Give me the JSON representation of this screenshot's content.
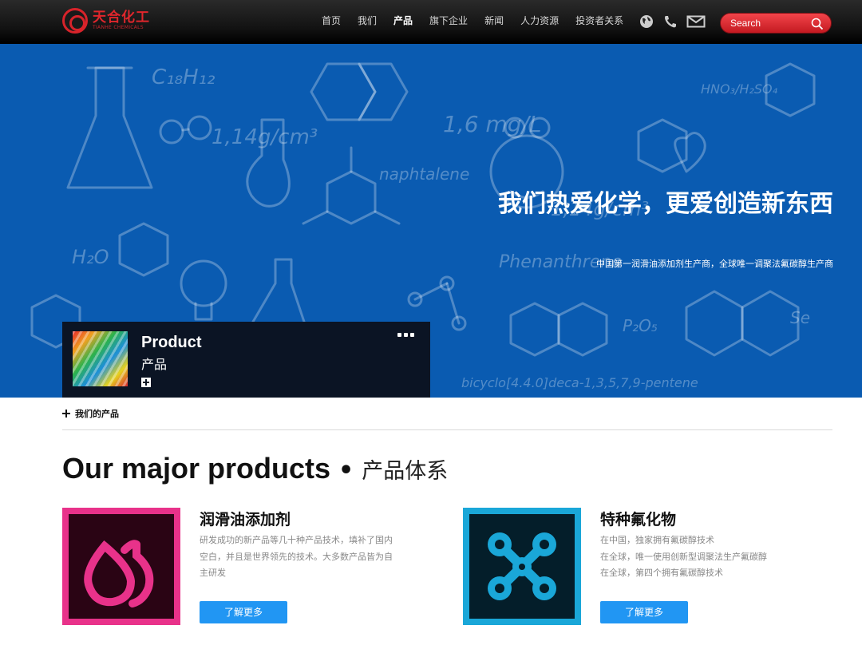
{
  "colors": {
    "accent_red": "#e0262c",
    "hero_blue": "#0a5bb1",
    "button_blue": "#2196f3",
    "product1_border": "#e8328a",
    "product2_border": "#1aa7d8"
  },
  "header": {
    "logo": {
      "cn": "天合化工",
      "en": "TIANHE CHEMICALS"
    },
    "nav": [
      {
        "label": "首页"
      },
      {
        "label": "我们"
      },
      {
        "label": "产品",
        "active": true
      },
      {
        "label": "旗下企业"
      },
      {
        "label": "新闻"
      },
      {
        "label": "人力资源"
      },
      {
        "label": "投资者关系"
      }
    ],
    "icons": [
      "globe-icon",
      "phone-icon",
      "mail-icon"
    ],
    "search": {
      "placeholder": "Search"
    }
  },
  "hero": {
    "title": "我们热爱化学，更爱创造新东西",
    "subtitle": "中国第一润滑油添加剂生产商，全球唯一调聚法氟碳醇生产商",
    "card": {
      "title_en": "Product",
      "title_cn": "产品"
    }
  },
  "breadcrumb": {
    "label": "我们的产品"
  },
  "section": {
    "title_en": "Our major products",
    "dot": "•",
    "title_cn": "产品体系"
  },
  "products": [
    {
      "name": "润滑油添加剂",
      "desc": [
        "研发成功的新产品等几十种产品技术，填补了国内",
        "空白，并且是世界领先的技术。大多数产品皆为自",
        "主研发"
      ],
      "button": "了解更多",
      "icon": "droplets-icon"
    },
    {
      "name": "特种氟化物",
      "desc": [
        "在中国，独家拥有氟碳醇技术",
        "在全球，唯一使用创新型调聚法生产氟碳醇",
        "在全球，第四个拥有氟碳醇技术"
      ],
      "button": "了解更多",
      "icon": "molecule-icon"
    }
  ]
}
